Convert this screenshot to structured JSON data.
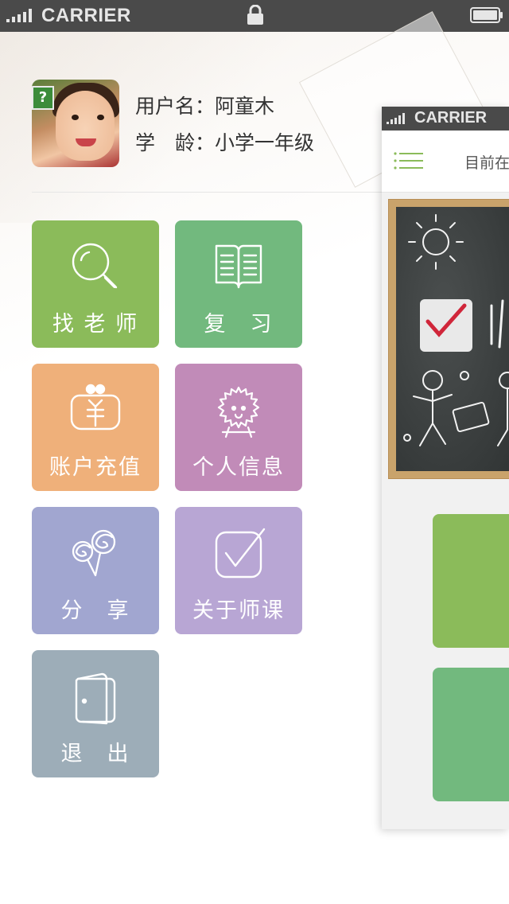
{
  "status_bar": {
    "carrier": "CARRIER",
    "signal_icon": "signal-bars-icon",
    "lock_icon": "lock-icon",
    "battery_icon": "battery-icon"
  },
  "profile": {
    "username_label": "用户名：",
    "username": "阿童木",
    "grade_label": "学　龄：",
    "grade": "小学一年级",
    "avatar_icon": "child-avatar"
  },
  "menu": [
    {
      "label": "找 老 师",
      "icon": "magnifier-icon",
      "color": "#8bbb5a"
    },
    {
      "label": "复　习",
      "icon": "open-book-icon",
      "color": "#72b97e"
    },
    {
      "label": "账户充值",
      "icon": "money-bag-icon",
      "color": "#efb07a"
    },
    {
      "label": "个人信息",
      "icon": "fluffy-character-icon",
      "color": "#c18bb8"
    },
    {
      "label": "分　享",
      "icon": "lollipop-icon",
      "color": "#a1a6d0"
    },
    {
      "label": "关于师课",
      "icon": "checkbox-icon",
      "color": "#b8a6d4"
    },
    {
      "label": "退　出",
      "icon": "exit-door-icon",
      "color": "#9dadb8"
    }
  ],
  "preview": {
    "carrier": "CARRIER",
    "menu_icon": "hamburger-menu-icon",
    "title": "目前在",
    "banner": "chalkboard-illustration",
    "card_colors": [
      "#8bbb5a",
      "#72b97e"
    ]
  }
}
